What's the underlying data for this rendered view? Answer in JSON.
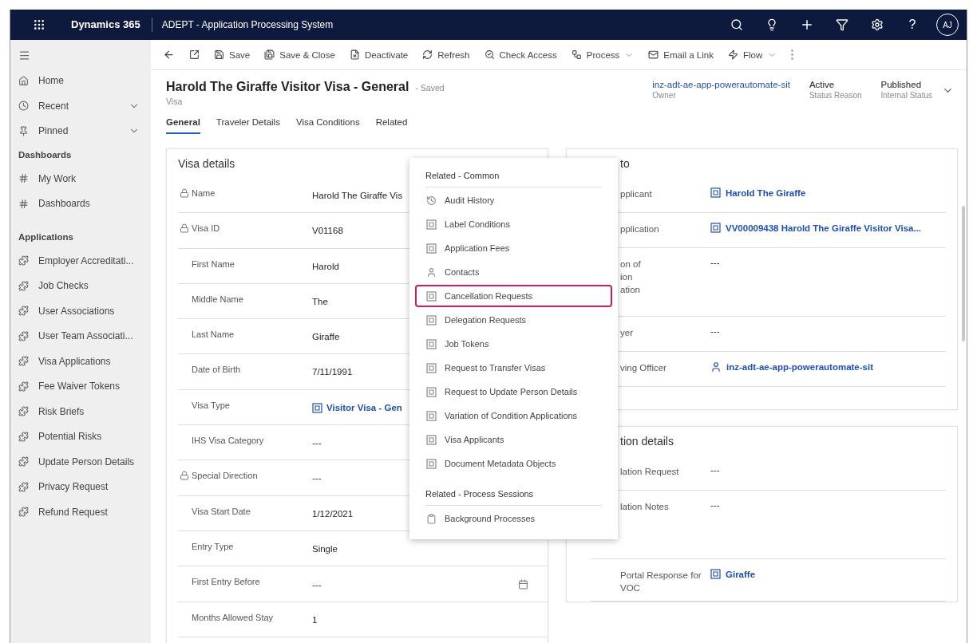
{
  "top_bar": {
    "product": "Dynamics 365",
    "app_name": "ADEPT - Application Processing System",
    "help": "?",
    "avatar": "AJ"
  },
  "sidebar": {
    "nav": [
      {
        "label": "Home",
        "expandable": false
      },
      {
        "label": "Recent",
        "expandable": true
      },
      {
        "label": "Pinned",
        "expandable": true
      }
    ],
    "sections": [
      {
        "title": "Dashboards",
        "kind": "dashboard",
        "items": [
          "My Work",
          "Dashboards"
        ]
      },
      {
        "title": "Applications",
        "kind": "entity",
        "items": [
          "Employer Accreditati...",
          "Job Checks",
          "User Associations",
          "User Team Associati...",
          "Visa Applications",
          "Fee Waiver Tokens",
          "Risk Briefs",
          "Potential Risks",
          "Update Person Details",
          "Privacy Request",
          "Refund Request"
        ]
      }
    ]
  },
  "toolbar": [
    {
      "label": "Save",
      "menu": false
    },
    {
      "label": "Save & Close",
      "menu": false
    },
    {
      "label": "Deactivate",
      "menu": false
    },
    {
      "label": "Refresh",
      "menu": false
    },
    {
      "label": "Check Access",
      "menu": false
    },
    {
      "label": "Process",
      "menu": true
    },
    {
      "label": "Email a Link",
      "menu": false
    },
    {
      "label": "Flow",
      "menu": true
    }
  ],
  "record": {
    "title": "Harold The Giraffe Visitor Visa - General",
    "save_state": "- Saved",
    "entity": "Visa",
    "header_fields": [
      {
        "value": "inz-adt-ae-app-powerautomate-sit",
        "label": "Owner",
        "kind": "link"
      },
      {
        "value": "Active",
        "label": "Status Reason",
        "kind": "text"
      },
      {
        "value": "Published",
        "label": "Internal Status",
        "kind": "text"
      }
    ]
  },
  "tabs": [
    {
      "label": "General",
      "selected": true
    },
    {
      "label": "Traveler Details",
      "selected": false
    },
    {
      "label": "Visa Conditions",
      "selected": false
    },
    {
      "label": "Related",
      "selected": false
    }
  ],
  "visa_details": {
    "title": "Visa details",
    "fields": [
      {
        "label": "Name",
        "value": "Harold The Giraffe Vis",
        "locked": true,
        "kind": "text"
      },
      {
        "label": "Visa ID",
        "value": "V01168",
        "locked": true,
        "kind": "text"
      },
      {
        "label": "First Name",
        "value": "Harold",
        "locked": false,
        "kind": "text"
      },
      {
        "label": "Middle Name",
        "value": "The",
        "locked": false,
        "kind": "text"
      },
      {
        "label": "Last Name",
        "value": "Giraffe",
        "locked": false,
        "kind": "text"
      },
      {
        "label": "Date of Birth",
        "value": "7/11/1991",
        "locked": false,
        "kind": "text"
      },
      {
        "label": "Visa Type",
        "value": "Visitor Visa - Gen",
        "locked": false,
        "kind": "lookup"
      },
      {
        "label": "IHS Visa Category",
        "value": "---",
        "locked": false,
        "kind": "text"
      },
      {
        "label": "Special Direction",
        "value": "---",
        "locked": true,
        "kind": "text"
      },
      {
        "label": "Visa Start Date",
        "value": "1/12/2021",
        "locked": false,
        "kind": "text"
      },
      {
        "label": "Entry Type",
        "value": "Single",
        "locked": false,
        "kind": "text"
      },
      {
        "label": "First Entry Before",
        "value": "---",
        "locked": false,
        "kind": "date"
      },
      {
        "label": "Months Allowed Stay",
        "value": "1",
        "locked": false,
        "kind": "text"
      }
    ]
  },
  "related_menu": {
    "groups": [
      {
        "title": "Related - Common",
        "items": [
          {
            "label": "Audit History",
            "kind": "audit",
            "highlighted": false
          },
          {
            "label": "Label Conditions",
            "kind": "entity",
            "highlighted": false
          },
          {
            "label": "Application Fees",
            "kind": "entity",
            "highlighted": false
          },
          {
            "label": "Contacts",
            "kind": "contact",
            "highlighted": false
          },
          {
            "label": "Cancellation Requests",
            "kind": "entity",
            "highlighted": true
          },
          {
            "label": "Delegation Requests",
            "kind": "entity",
            "highlighted": false
          },
          {
            "label": "Job Tokens",
            "kind": "entity",
            "highlighted": false
          },
          {
            "label": "Request to Transfer Visas",
            "kind": "entity",
            "highlighted": false
          },
          {
            "label": "Request to Update Person Details",
            "kind": "entity",
            "highlighted": false
          },
          {
            "label": "Variation of Condition Applications",
            "kind": "entity",
            "highlighted": false
          },
          {
            "label": "Visa Applicants",
            "kind": "entity",
            "highlighted": false
          },
          {
            "label": "Document Metadata Objects",
            "kind": "entity",
            "highlighted": false
          }
        ]
      },
      {
        "title": "Related - Process Sessions",
        "items": [
          {
            "label": "Background Processes",
            "kind": "process",
            "highlighted": false
          }
        ]
      }
    ]
  },
  "right_sections": [
    {
      "title": "to",
      "fields": [
        {
          "label_lines": [
            "pplicant"
          ],
          "value": "Harold The Giraffe",
          "kind": "lookup"
        },
        {
          "label_lines": [
            "pplication"
          ],
          "value": "VV00009438 Harold The Giraffe Visitor Visa...",
          "kind": "lookup"
        },
        {
          "label_lines": [
            "on of",
            "ion",
            "ation"
          ],
          "value": "---",
          "kind": "text"
        },
        {
          "label_lines": [
            "yer"
          ],
          "value": "---",
          "kind": "text"
        },
        {
          "label_lines": [
            "ving Officer"
          ],
          "value": "inz-adt-ae-app-powerautomate-sit",
          "kind": "user"
        }
      ]
    },
    {
      "title": "tion details",
      "fields": [
        {
          "label_lines": [
            "lation Request"
          ],
          "value": "---",
          "kind": "text"
        },
        {
          "label_lines": [
            "lation Notes"
          ],
          "value": "---",
          "kind": "multiline"
        },
        {
          "label_lines": [
            "Portal Response for",
            "VOC"
          ],
          "value": "Giraffe",
          "kind": "lookup"
        }
      ]
    }
  ]
}
